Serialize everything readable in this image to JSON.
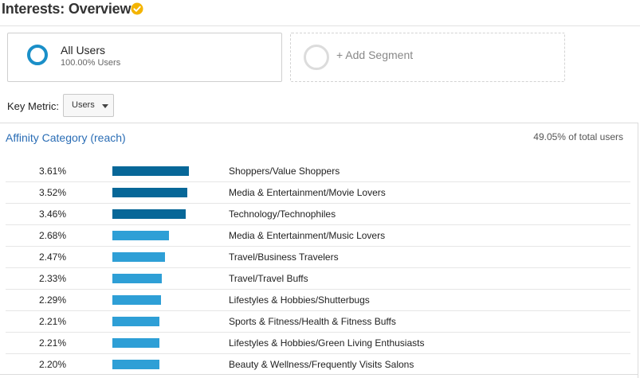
{
  "header": {
    "title": "Interests: Overview",
    "verified_icon": "check-badge-icon",
    "verified_color": "#f4b400"
  },
  "segments": {
    "active": {
      "name": "All Users",
      "subtitle": "100.00% Users",
      "ring_color": "#1a8fc8"
    },
    "add": {
      "label": "+ Add Segment",
      "ring_color": "#dcdcdc"
    }
  },
  "key_metric": {
    "label": "Key Metric:",
    "value": "Users",
    "icon": "chevron-down-icon"
  },
  "affinity": {
    "title": "Affinity Category (reach)",
    "total_text": "49.05% of total users",
    "colors": {
      "top": "#076798",
      "rest": "#2e9fd6"
    },
    "rows": [
      {
        "pct": "3.61%",
        "value": 3.61,
        "label": "Shoppers/Value Shoppers"
      },
      {
        "pct": "3.52%",
        "value": 3.52,
        "label": "Media & Entertainment/Movie Lovers"
      },
      {
        "pct": "3.46%",
        "value": 3.46,
        "label": "Technology/Technophiles"
      },
      {
        "pct": "2.68%",
        "value": 2.68,
        "label": "Media & Entertainment/Music Lovers"
      },
      {
        "pct": "2.47%",
        "value": 2.47,
        "label": "Travel/Business Travelers"
      },
      {
        "pct": "2.33%",
        "value": 2.33,
        "label": "Travel/Travel Buffs"
      },
      {
        "pct": "2.29%",
        "value": 2.29,
        "label": "Lifestyles & Hobbies/Shutterbugs"
      },
      {
        "pct": "2.21%",
        "value": 2.21,
        "label": "Sports & Fitness/Health & Fitness Buffs"
      },
      {
        "pct": "2.21%",
        "value": 2.21,
        "label": "Lifestyles & Hobbies/Green Living Enthusiasts"
      },
      {
        "pct": "2.20%",
        "value": 2.2,
        "label": "Beauty & Wellness/Frequently Visits Salons"
      }
    ]
  }
}
